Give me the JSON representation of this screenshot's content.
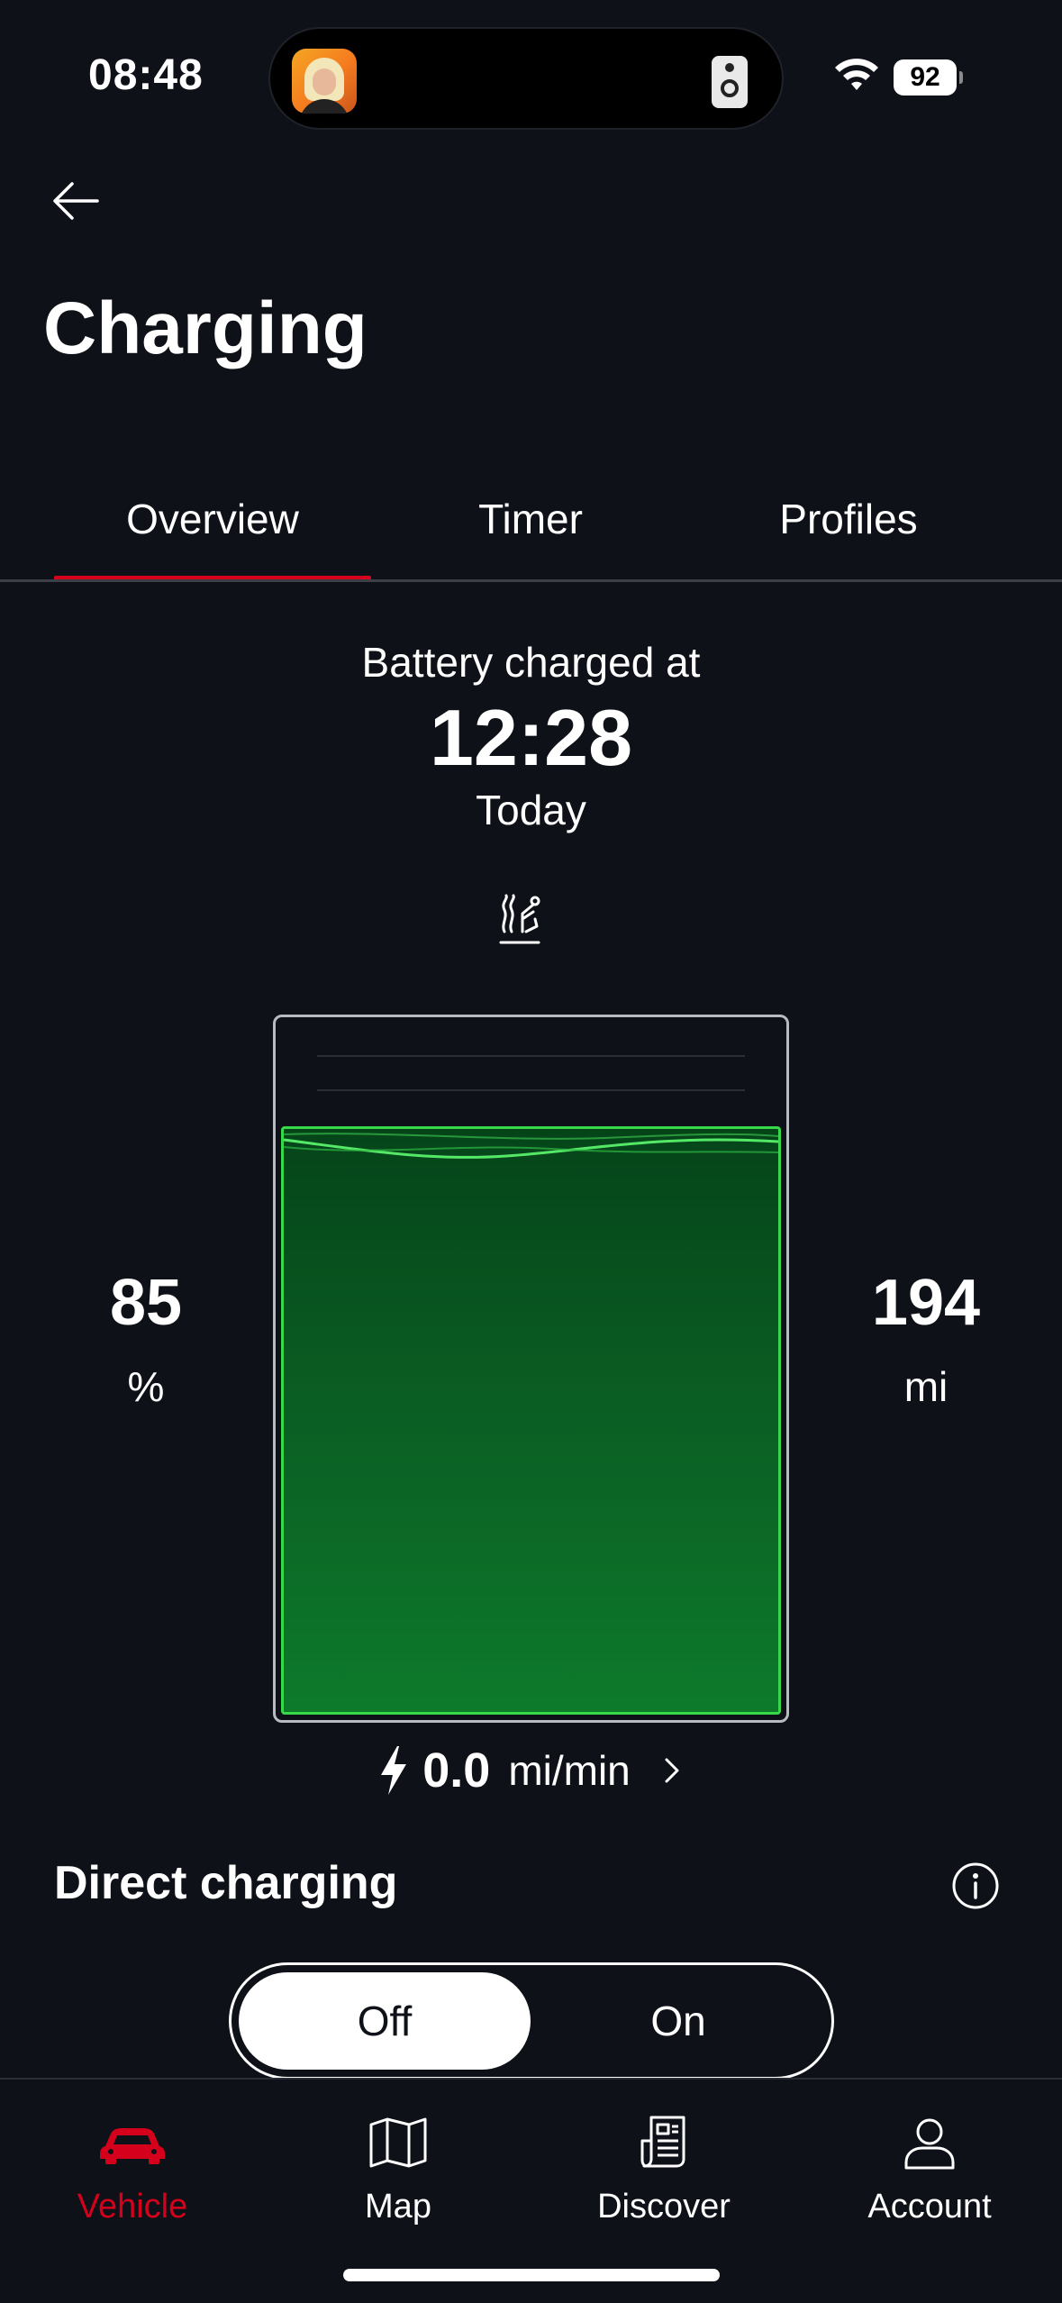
{
  "status_bar": {
    "time": "08:48",
    "battery_level": "92",
    "icons": [
      "wifi-icon",
      "battery-icon",
      "speaker-icon"
    ]
  },
  "header": {
    "back_icon": "arrow-left-icon",
    "title": "Charging"
  },
  "tabs": [
    {
      "label": "Overview",
      "active": true
    },
    {
      "label": "Timer",
      "active": false
    },
    {
      "label": "Profiles",
      "active": false
    }
  ],
  "charge_status": {
    "label": "Battery charged at",
    "time": "12:28",
    "day": "Today",
    "climate_icon": "seat-heat-icon"
  },
  "battery": {
    "percent_value": "85",
    "percent_unit": "%",
    "range_value": "194",
    "range_unit": "mi",
    "fill_fraction": 0.85,
    "fill_color": "#0d7a2b",
    "fill_border_color": "#37d94a"
  },
  "charging_rate": {
    "value": "0.0",
    "unit": "mi/min"
  },
  "direct_charging": {
    "title": "Direct charging",
    "toggle": {
      "off_label": "Off",
      "on_label": "On",
      "selected": "off"
    }
  },
  "bottom_nav": [
    {
      "label": "Vehicle",
      "icon": "car-icon",
      "active": true
    },
    {
      "label": "Map",
      "icon": "map-icon",
      "active": false
    },
    {
      "label": "Discover",
      "icon": "news-icon",
      "active": false
    },
    {
      "label": "Account",
      "icon": "user-icon",
      "active": false
    }
  ],
  "colors": {
    "accent": "#d5001c",
    "background": "#0e1118"
  }
}
